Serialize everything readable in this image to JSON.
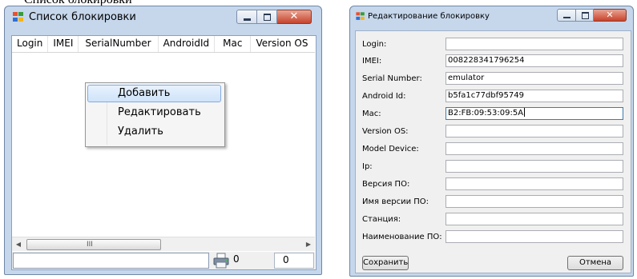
{
  "top_crop_text": "Список блокировки",
  "left_window": {
    "title": "Список блокировки",
    "columns": [
      "Login",
      "IMEI",
      "SerialNumber",
      "AndroidId",
      "Mac",
      "Version OS"
    ],
    "scrollbar_grip": "III",
    "status_value_1": "0",
    "status_value_2": "0",
    "context_menu": {
      "items": [
        "Добавить",
        "Редактировать",
        "Удалить"
      ],
      "highlighted": "Добавить"
    }
  },
  "right_window": {
    "title": "Редактирование блокировку",
    "fields": [
      {
        "label": "Login:",
        "value": ""
      },
      {
        "label": "IMEI:",
        "value": "008228341796254"
      },
      {
        "label": "Serial Number:",
        "value": "emulator"
      },
      {
        "label": "Android Id:",
        "value": "b5fa1c77dbf95749"
      },
      {
        "label": "Mac:",
        "value": "B2:FB:09:53:09:5A"
      },
      {
        "label": "Version OS:",
        "value": ""
      },
      {
        "label": "Model Device:",
        "value": ""
      },
      {
        "label": "Ip:",
        "value": ""
      },
      {
        "label": "Версия ПО:",
        "value": ""
      },
      {
        "label": "Имя версии ПО:",
        "value": ""
      },
      {
        "label": "Станция:",
        "value": ""
      },
      {
        "label": "Наименование ПО:",
        "value": ""
      }
    ],
    "focused_field": "Mac:",
    "save_label": "Сохранить",
    "cancel_label": "Отмена"
  },
  "colors": {
    "frame": "#c6d7ec",
    "close_button": "#c7432b",
    "menu_highlight": "#cfe3fa"
  },
  "icons": [
    "app-window-icon",
    "minimize-icon",
    "maximize-icon",
    "close-icon",
    "printer-icon",
    "scroll-left-icon",
    "scroll-right-icon"
  ]
}
